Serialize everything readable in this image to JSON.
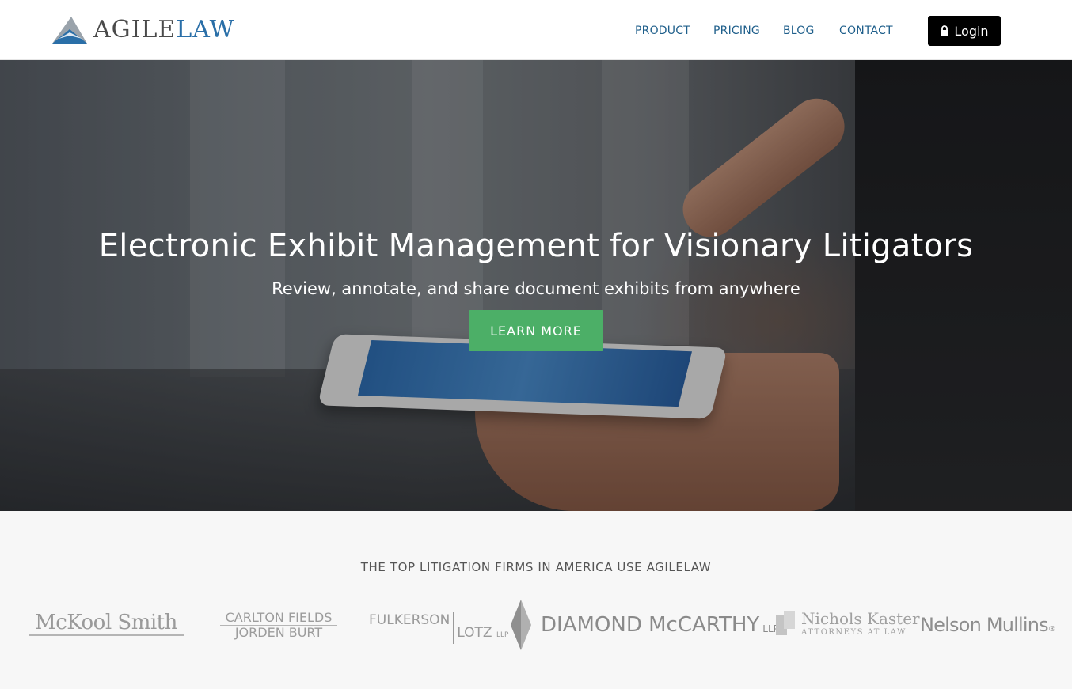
{
  "header": {
    "logo": {
      "agile": "AGILE",
      "law": "LAW"
    },
    "nav": [
      {
        "label": "PRODUCT"
      },
      {
        "label": "PRICING"
      },
      {
        "label": "BLOG"
      },
      {
        "label": "CONTACT"
      }
    ],
    "login_label": "Login"
  },
  "hero": {
    "title": "Electronic Exhibit Management for Visionary Litigators",
    "subtitle": "Review, annotate, and share document exhibits from anywhere",
    "cta_label": "LEARN MORE"
  },
  "clients": {
    "title": "THE TOP LITIGATION FIRMS IN AMERICA USE AGILELAW",
    "logos": [
      {
        "name": "McKool Smith"
      },
      {
        "line1": "CARLTON FIELDS",
        "line2": "JORDEN BURT"
      },
      {
        "name1": "FULKERSON",
        "name2": "LOTZ",
        "suffix": "LLP"
      },
      {
        "name": "DIAMOND McCARTHY",
        "suffix": "LLP"
      },
      {
        "name": "Nichols Kaster",
        "sub": "ATTORNEYS AT LAW"
      },
      {
        "name": "Nelson Mullins"
      }
    ]
  },
  "colors": {
    "nav_link": "#1f5f8b",
    "login_bg": "#000000",
    "cta_bg": "#4caf67",
    "logo_law": "#2a6fa8"
  }
}
